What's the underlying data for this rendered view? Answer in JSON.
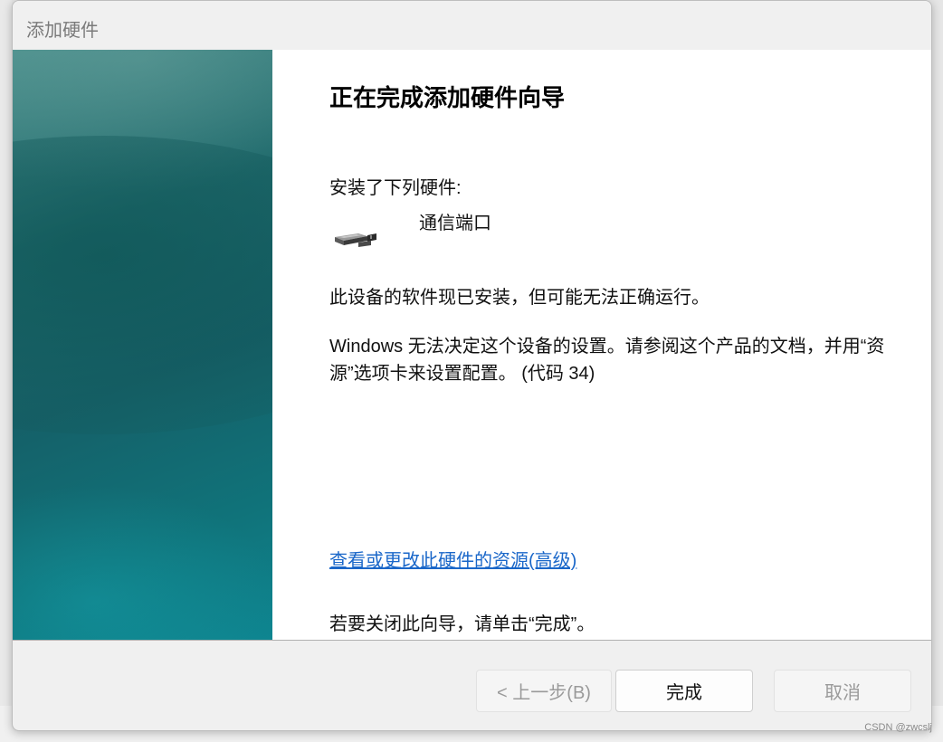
{
  "window": {
    "title": "添加硬件"
  },
  "wizard": {
    "heading": "正在完成添加硬件向导",
    "installed_label": "安装了下列硬件:",
    "device": {
      "icon": "serial-port-icon",
      "name": "通信端口"
    },
    "status_line1": "此设备的软件现已安装，但可能无法正确运行。",
    "status_line2": "Windows 无法决定这个设备的设置。请参阅这个产品的文档，并用“资源”选项卡来设置配置。 (代码 34)",
    "resources_link": "查看或更改此硬件的资源(高级)",
    "close_hint": "若要关闭此向导，请单击“完成”。"
  },
  "buttons": {
    "back": "< 上一步(B)",
    "finish": "完成",
    "cancel": "取消"
  },
  "watermark": "CSDN @zwcslj",
  "colors": {
    "link": "#1a67c9",
    "side_panel": "#156068"
  }
}
